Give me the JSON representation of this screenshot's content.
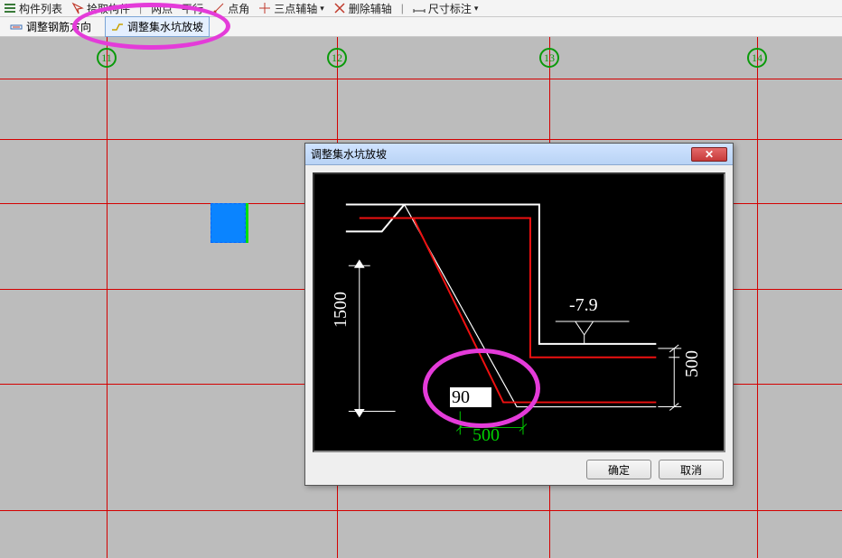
{
  "toolbar1": {
    "items": [
      "构件列表",
      "拾取构件",
      "两点",
      "平行",
      "点角",
      "三点辅轴",
      "删除辅轴",
      "尺寸标注"
    ]
  },
  "toolbar2": {
    "btn1": "调整钢筋方向",
    "btn2": "调整集水坑放坡"
  },
  "grid_labels": [
    "11",
    "12",
    "13",
    "14"
  ],
  "dialog": {
    "title": "调整集水坑放坡",
    "ok": "确定",
    "cancel": "取消",
    "dim_vertical": "1500",
    "dim_right_v": "500",
    "dim_bottom": "500",
    "elev_text": "-7.9",
    "angle_input": "90"
  }
}
